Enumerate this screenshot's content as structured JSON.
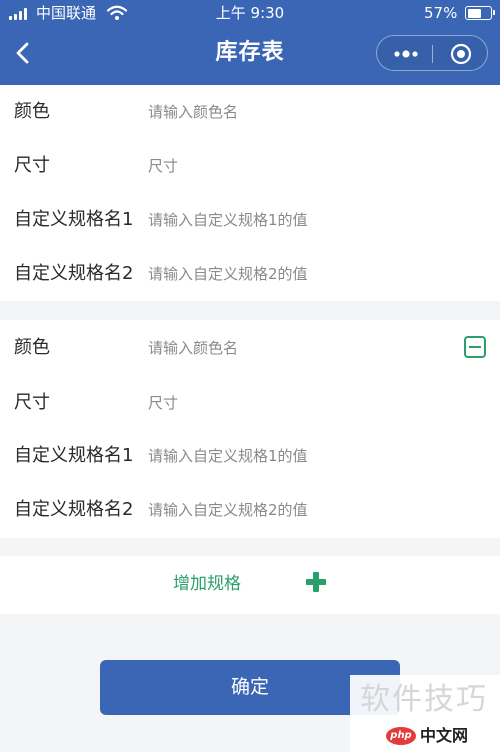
{
  "status_bar": {
    "carrier": "中国联通",
    "time": "上午 9:30",
    "battery": "57%",
    "icons": [
      "signal-icon",
      "wifi-icon",
      "battery-icon"
    ]
  },
  "nav": {
    "title": "库存表",
    "back_icon": "chevron-left-icon",
    "more_icon": "more-dots-icon",
    "close_icon": "capsule-close-icon"
  },
  "spec_groups": [
    {
      "rows": [
        {
          "label": "颜色",
          "placeholder": "请输入颜色名"
        },
        {
          "label": "尺寸",
          "placeholder": "尺寸"
        },
        {
          "label": "自定义规格名1",
          "placeholder": "请输入自定义规格1的值"
        },
        {
          "label": "自定义规格名2",
          "placeholder": "请输入自定义规格2的值"
        }
      ]
    },
    {
      "remove_icon": "minus-square-icon",
      "rows": [
        {
          "label": "颜色",
          "placeholder": "请输入颜色名"
        },
        {
          "label": "尺寸",
          "placeholder": "尺寸"
        },
        {
          "label": "自定义规格名1",
          "placeholder": "请输入自定义规格1的值"
        },
        {
          "label": "自定义规格名2",
          "placeholder": "请输入自定义规格2的值"
        }
      ]
    }
  ],
  "add_spec": {
    "label": "增加规格",
    "icon": "plus-icon"
  },
  "confirm": {
    "label": "确定"
  },
  "watermark": {
    "main": "软件技巧",
    "logo": "php",
    "sub": "中文网"
  },
  "colors": {
    "primary": "#3a66b5",
    "accent_green": "#2a9e6b",
    "background": "#f4f5f7"
  }
}
